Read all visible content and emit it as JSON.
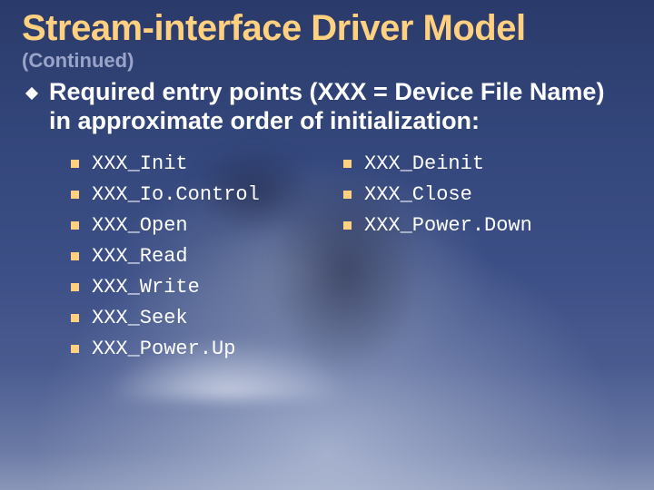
{
  "title": "Stream-interface Driver Model",
  "subtitle": "(Continued)",
  "lead": "Required entry points (XXX = Device File Name) in approximate order of initialization:",
  "columns": {
    "left": [
      "XXX_Init",
      "XXX_Io.Control",
      "XXX_Open",
      "XXX_Read",
      "XXX_Write",
      "XXX_Seek",
      "XXX_Power.Up"
    ],
    "right": [
      "XXX_Deinit",
      "XXX_Close",
      "XXX_Power.Down"
    ]
  }
}
